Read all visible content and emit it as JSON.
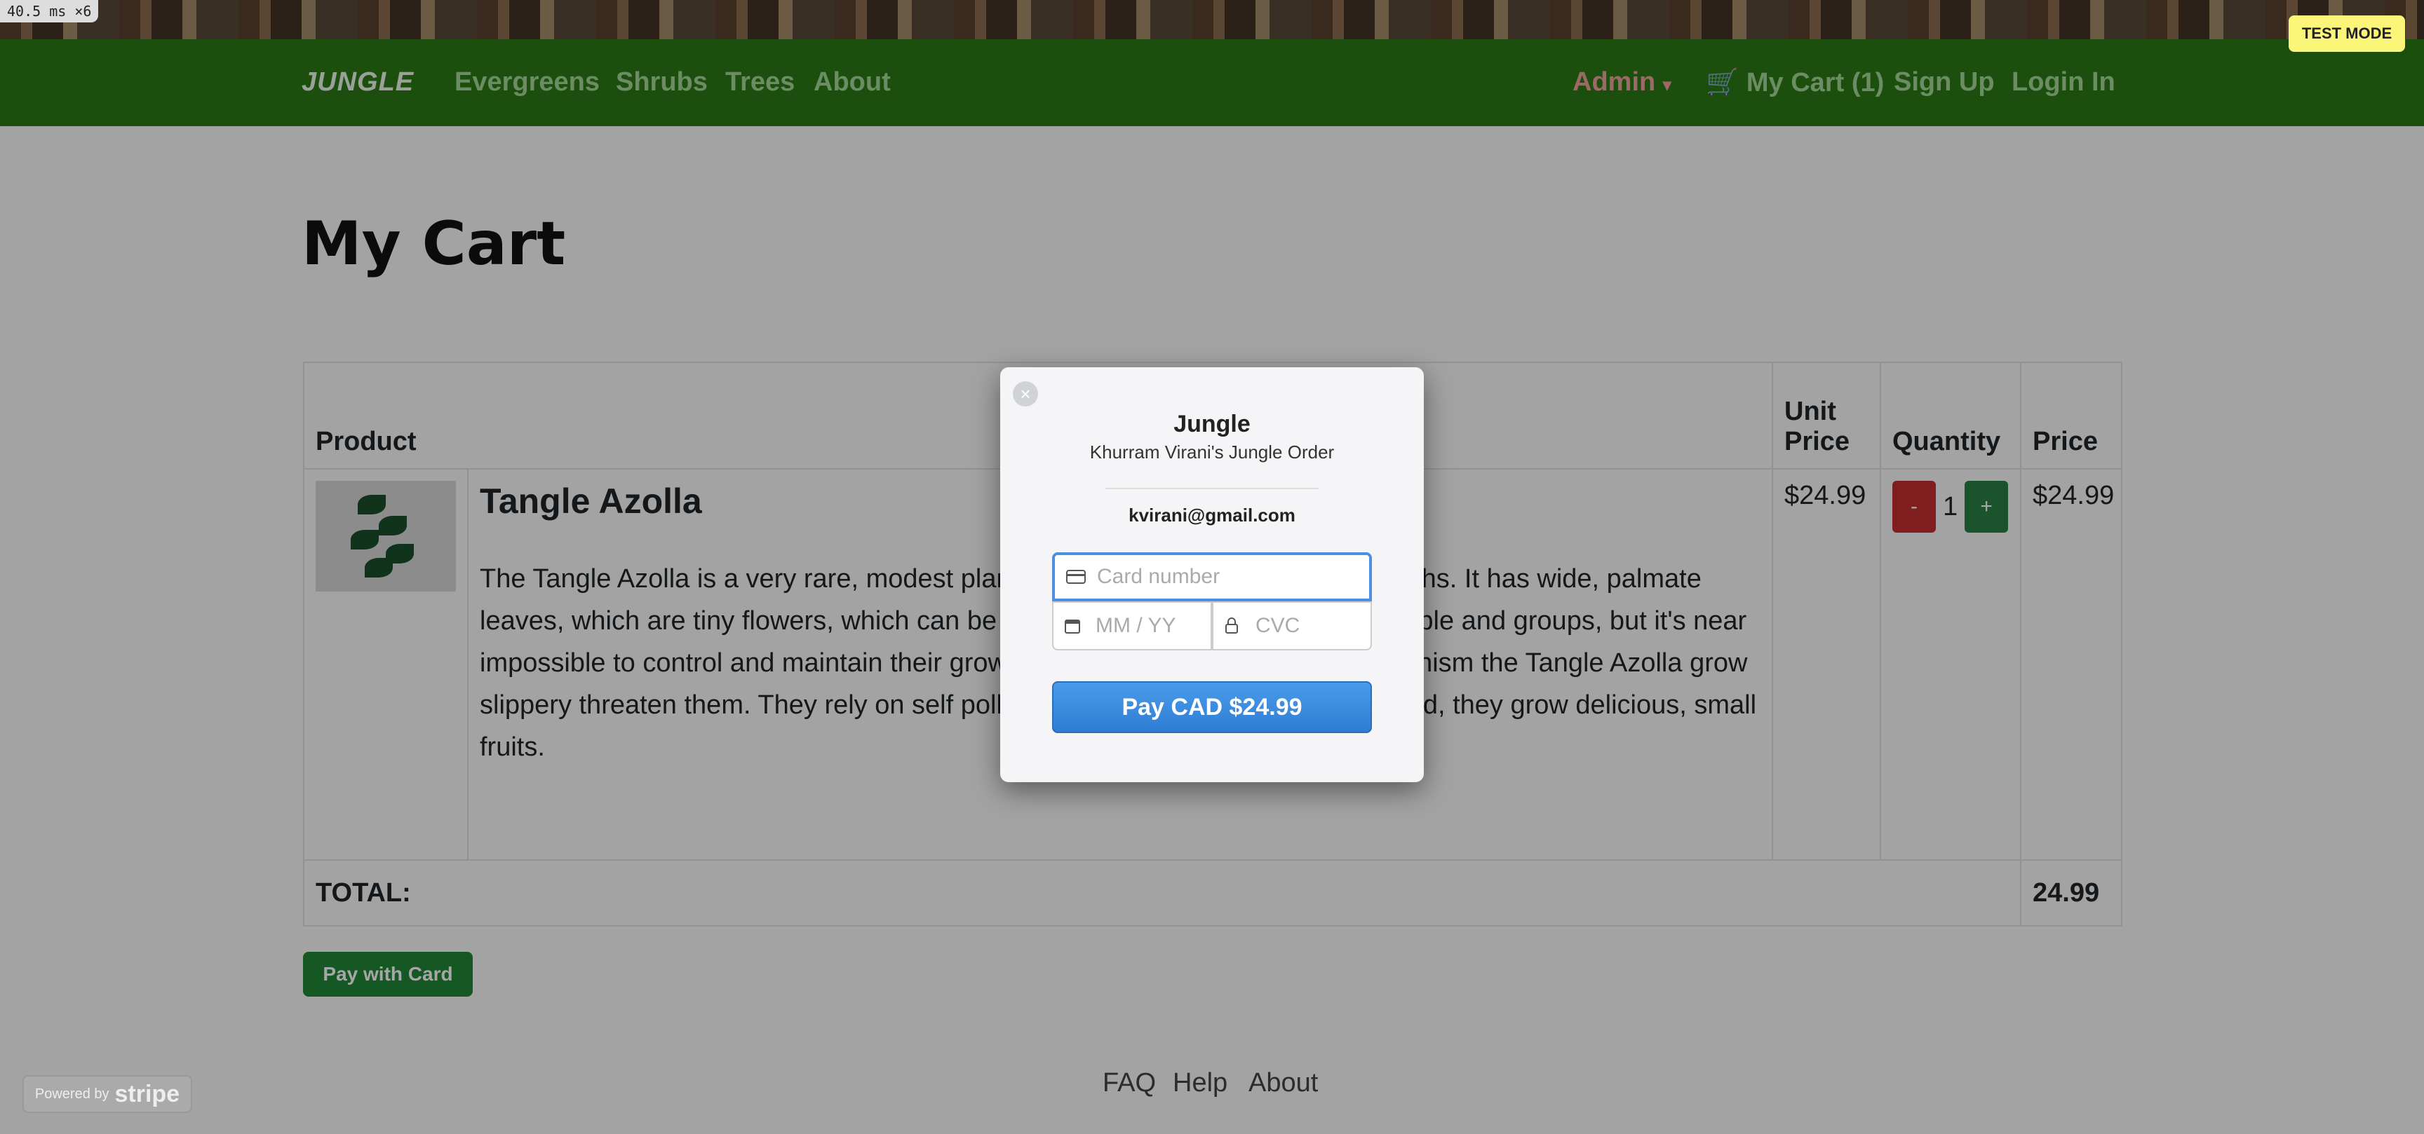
{
  "debug": {
    "perf_label": "40.5 ms ×6"
  },
  "test_mode": "TEST MODE",
  "nav": {
    "brand": "JUNGLE",
    "links": [
      "Evergreens",
      "Shrubs",
      "Trees",
      "About"
    ],
    "admin": "Admin",
    "cart": "My Cart (1)",
    "signup": "Sign Up",
    "login": "Login In"
  },
  "page_title": "My Cart",
  "table": {
    "headers": {
      "product": "Product",
      "unit_price": "Unit Price",
      "quantity": "Quantity",
      "price": "Price"
    },
    "rows": [
      {
        "name": "Tangle Azolla",
        "description": "The Tangle Azolla is a very rare, modest plant. It blooms once a year, for 2 months. It has wide, palmate leaves, which are tiny flowers, which can be light grey, white, light blue, light purple and groups, but it's near impossible to control and maintain their growth in gardens. As a defense mechanism the Tangle Azolla grow slippery threaten them. They rely on self pollination to reproduce. Once pollinated, they grow delicious, small fruits.",
        "unit_price": "$24.99",
        "quantity": "1",
        "minus": "-",
        "plus": "+",
        "price": "$24.99"
      }
    ],
    "total_label": "TOTAL:",
    "total_value": "24.99"
  },
  "pay_with_card": "Pay with Card",
  "footer": {
    "faq": "FAQ",
    "help": "Help",
    "about": "About"
  },
  "stripe_badge": {
    "powered_by": "Powered by",
    "brand": "stripe"
  },
  "modal": {
    "close_icon": "×",
    "title": "Jungle",
    "subtitle": "Khurram Virani's Jungle Order",
    "email": "kvirani@gmail.com",
    "card_placeholder": "Card number",
    "expiry_placeholder": "MM / YY",
    "cvc_placeholder": "CVC",
    "pay_button": "Pay CAD $24.99"
  }
}
